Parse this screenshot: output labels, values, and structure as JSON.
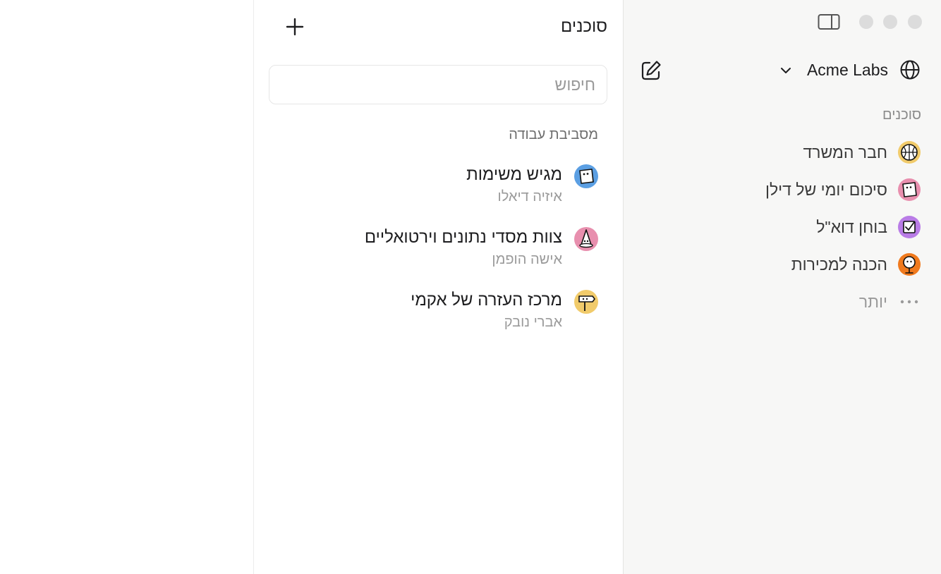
{
  "sidebar": {
    "workspace_name": "Acme Labs",
    "section_label": "סוכנים",
    "items": [
      {
        "label": "חבר המשרד",
        "icon": "basketball-face-icon",
        "color": "#f1cb6b"
      },
      {
        "label": "סיכום יומי של דילן",
        "icon": "note-face-icon",
        "color": "#e88fae"
      },
      {
        "label": "בוחן דוא\"ל",
        "icon": "checkbox-face-icon",
        "color": "#b97ce6"
      },
      {
        "label": "הכנה למכירות",
        "icon": "microphone-face-icon",
        "color": "#f07a1e"
      }
    ],
    "more_label": "יותר"
  },
  "middle": {
    "title": "סוכנים",
    "search_placeholder": "חיפוש",
    "section_label": "מסביבת עבודה",
    "agents": [
      {
        "name": "מגיש משימות",
        "owner": "איזיה דיאלו",
        "icon": "paper-face-icon",
        "color": "#5b9fe3"
      },
      {
        "name": "צוות מסדי נתונים וירטואליים",
        "owner": "אישה הופמן",
        "icon": "hat-face-icon",
        "color": "#e88fae"
      },
      {
        "name": "מרכז העזרה של אקמי",
        "owner": "אברי נובק",
        "icon": "signpost-face-icon",
        "color": "#f1cb6b"
      }
    ]
  }
}
